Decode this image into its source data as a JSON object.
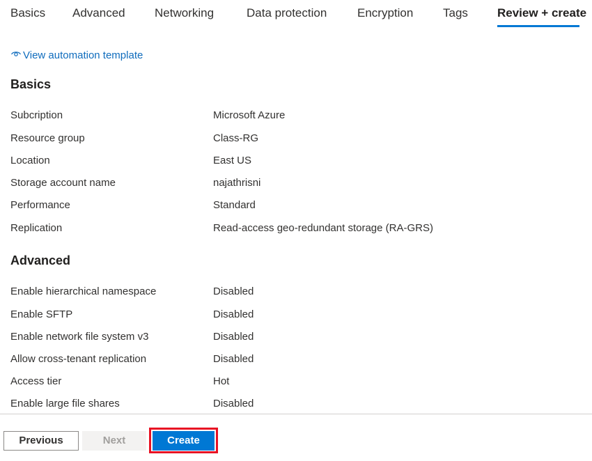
{
  "tabs": [
    {
      "label": "Basics"
    },
    {
      "label": "Advanced"
    },
    {
      "label": "Networking"
    },
    {
      "label": "Data protection"
    },
    {
      "label": "Encryption"
    },
    {
      "label": "Tags"
    },
    {
      "label": "Review + create",
      "active": true
    }
  ],
  "automation": {
    "label": "View automation template",
    "icon": "eye-icon"
  },
  "sections": {
    "basics": {
      "title": "Basics",
      "rows": [
        {
          "label": "Subcription",
          "value": "Microsoft Azure"
        },
        {
          "label": "Resource group",
          "value": "Class-RG"
        },
        {
          "label": "Location",
          "value": "East US"
        },
        {
          "label": "Storage account name",
          "value": "najathrisni"
        },
        {
          "label": "Performance",
          "value": "Standard"
        },
        {
          "label": "Replication",
          "value": "Read-access geo-redundant storage (RA-GRS)"
        }
      ]
    },
    "advanced": {
      "title": "Advanced",
      "rows": [
        {
          "label": "Enable hierarchical namespace",
          "value": "Disabled"
        },
        {
          "label": "Enable SFTP",
          "value": "Disabled"
        },
        {
          "label": "Enable network file system v3",
          "value": "Disabled"
        },
        {
          "label": "Allow cross-tenant replication",
          "value": "Disabled"
        },
        {
          "label": "Access tier",
          "value": "Hot"
        },
        {
          "label": "Enable large file shares",
          "value": "Disabled"
        }
      ]
    }
  },
  "footer": {
    "previous_label": "Previous",
    "next_label": "Next",
    "create_label": "Create"
  },
  "colors": {
    "accent": "#0078d4",
    "link": "#0f6cbd",
    "highlight": "#e81123"
  }
}
